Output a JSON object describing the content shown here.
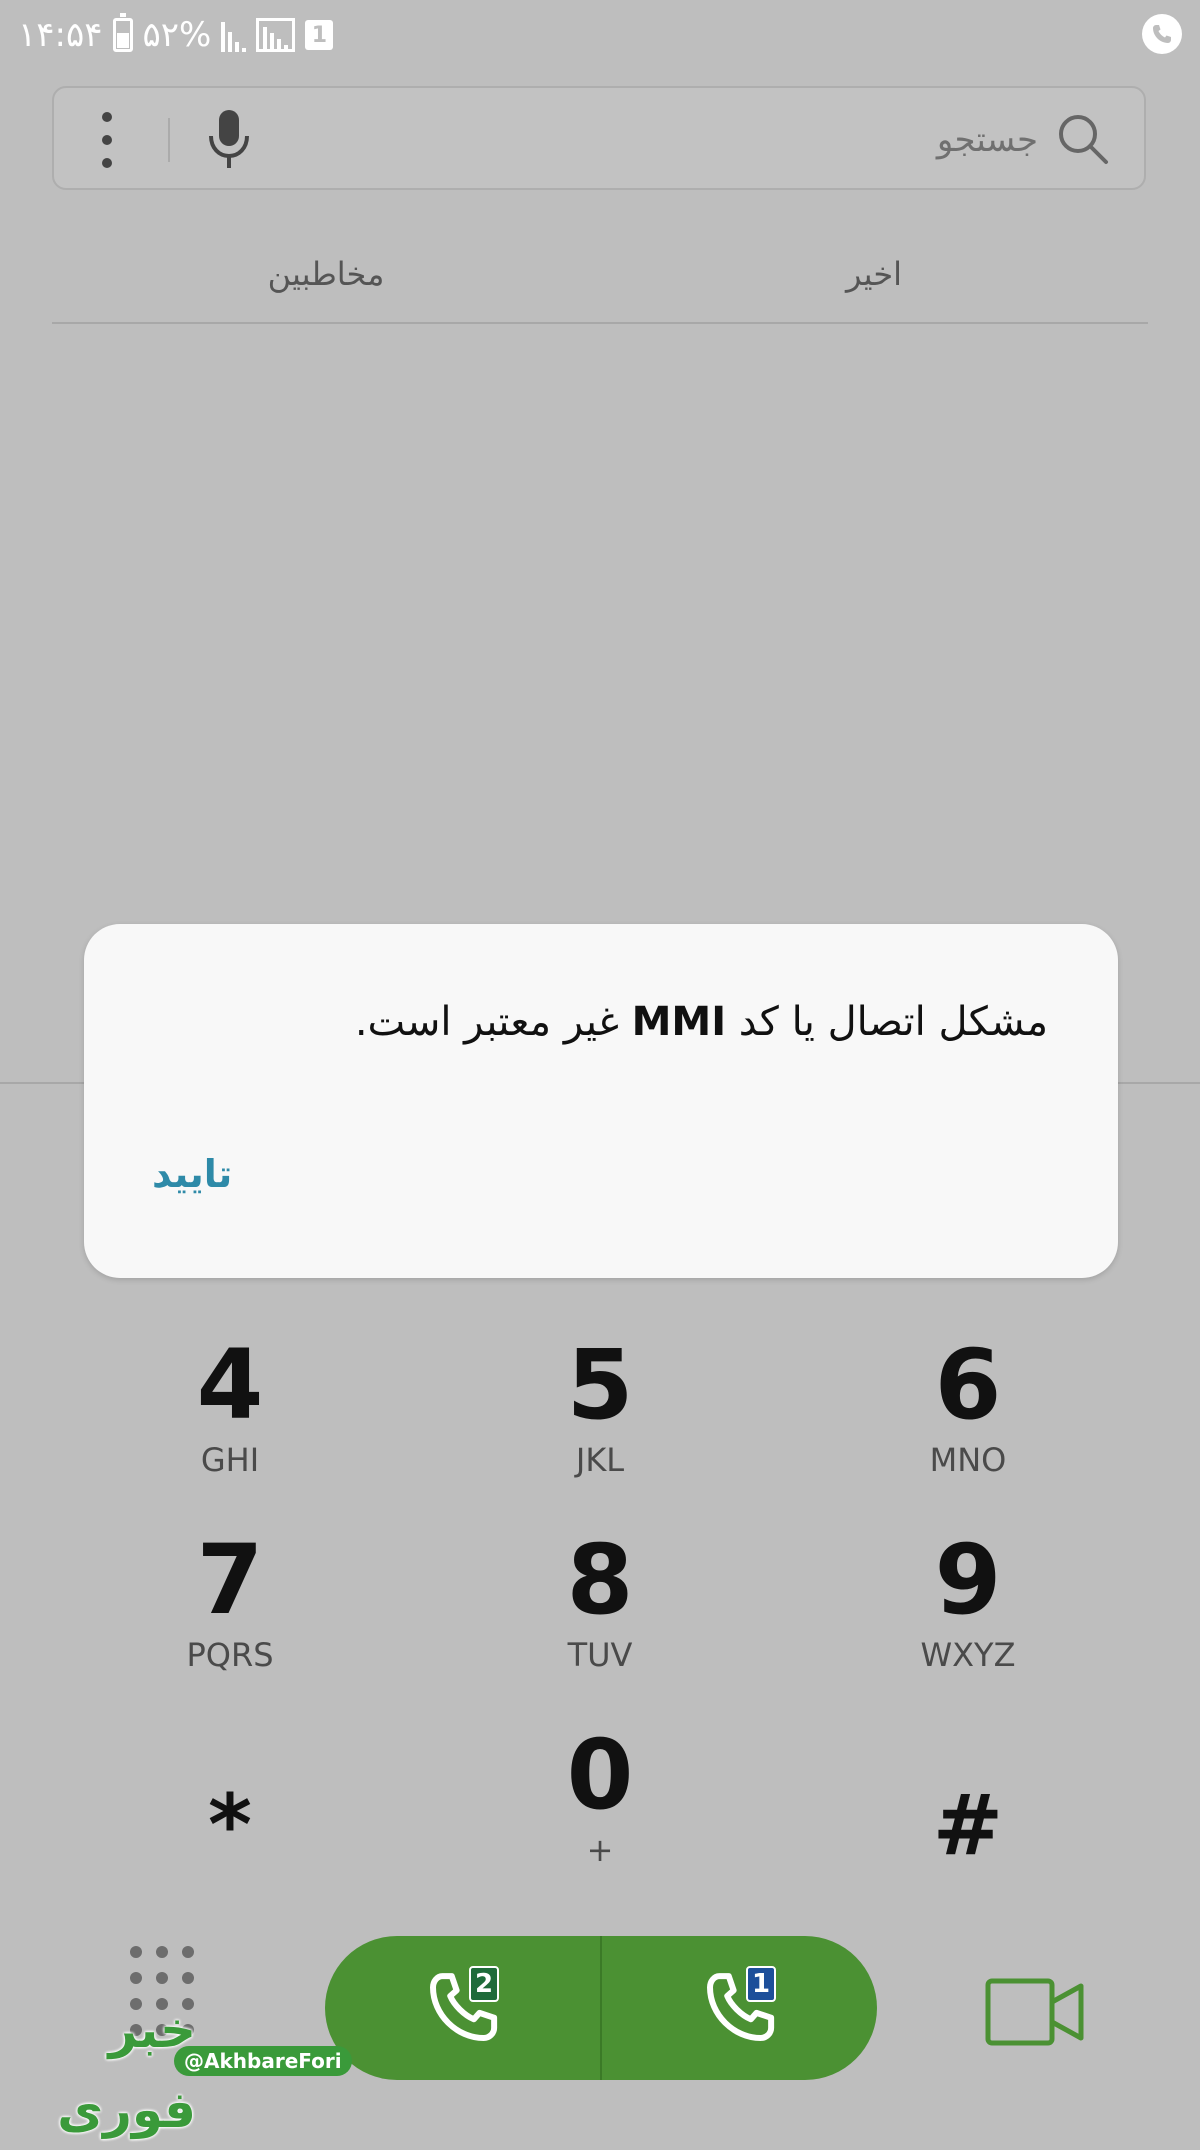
{
  "status_bar": {
    "time": "۱۴:۵۴",
    "battery": "۵۲%",
    "sim_indicator": "1",
    "icons": [
      "battery-icon",
      "signal-icon",
      "signal-box-icon",
      "sim1-icon",
      "call-active-icon"
    ]
  },
  "search": {
    "placeholder": "جستجو",
    "icons": [
      "search-icon",
      "mic-icon",
      "more-vert-icon"
    ]
  },
  "tabs": [
    {
      "label": "مخاطبین"
    },
    {
      "label": "اخیر"
    }
  ],
  "dialog": {
    "message_part1": "مشکل اتصال یا کد ",
    "message_bold": "MMI",
    "message_part2": " غیر معتبر است.",
    "ok_label": "تایید"
  },
  "keypad": [
    {
      "digit": "4",
      "letters": "GHI"
    },
    {
      "digit": "5",
      "letters": "JKL"
    },
    {
      "digit": "6",
      "letters": "MNO"
    },
    {
      "digit": "7",
      "letters": "PQRS"
    },
    {
      "digit": "8",
      "letters": "TUV"
    },
    {
      "digit": "9",
      "letters": "WXYZ"
    },
    {
      "digit": "*",
      "letters": ""
    },
    {
      "digit": "0",
      "letters": "+"
    },
    {
      "digit": "#",
      "letters": ""
    }
  ],
  "bottom_bar": {
    "call_sim2_badge": "2",
    "call_sim1_badge": "1",
    "icons": [
      "dialpad-icon",
      "phone-icon",
      "video-call-icon"
    ]
  },
  "watermark": {
    "handle": "@AkhbareFori",
    "logo_text": "خبر فوری"
  },
  "colors": {
    "background": "#bebebe",
    "dialog": "#f8f8f8",
    "accent": "#2e8aa8",
    "call_green": "#4b9133",
    "video_green": "#4b9133"
  }
}
